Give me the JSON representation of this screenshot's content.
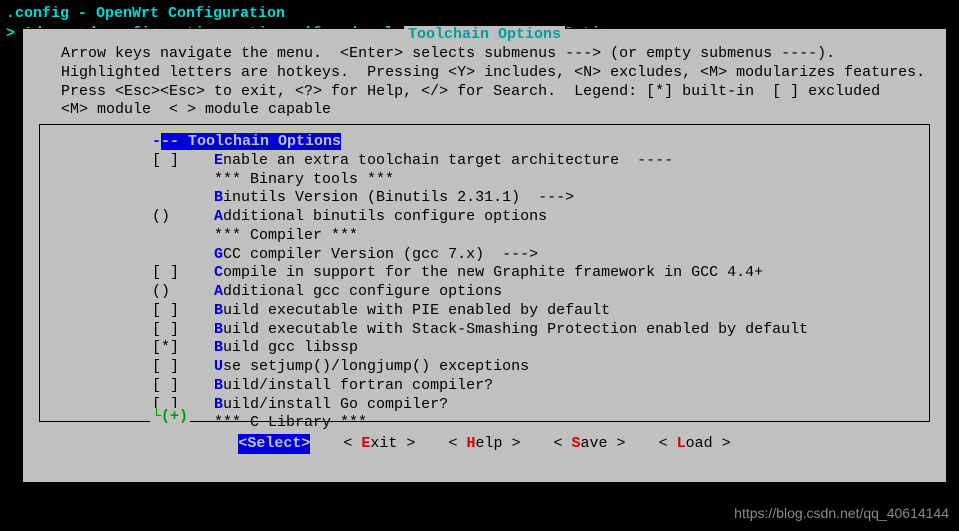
{
  "titleBar": ".config - OpenWrt Configuration",
  "breadcrumb": {
    "prefix": " > ",
    "parent": "Advanced configuration options (for developers)",
    "sep": " > ",
    "current": "Toolchain Options"
  },
  "panel": {
    "title": "Toolchain Options",
    "help": "  Arrow keys navigate the menu.  <Enter> selects submenus ---> (or empty submenus ----).\n  Highlighted letters are hotkeys.  Pressing <Y> includes, <N> excludes, <M> modularizes features.\n  Press <Esc><Esc> to exit, <?> for Help, </> for Search.  Legend: [*] built-in  [ ] excluded\n  <M> module  < > module capable",
    "moreIndicator": "└(+)"
  },
  "menuItems": [
    {
      "bracket": "---",
      "hotkey": "",
      "text": " Toolchain Options",
      "highlighted": true
    },
    {
      "bracket": "[ ]",
      "hotkey": "E",
      "text": "nable an extra toolchain target architecture  ----"
    },
    {
      "bracket": "   ",
      "hotkey": "",
      "text": "*** Binary tools ***"
    },
    {
      "bracket": "   ",
      "hotkey": "B",
      "text": "inutils Version (Binutils 2.31.1)  --->"
    },
    {
      "bracket": "() ",
      "hotkey": "A",
      "text": "dditional binutils configure options"
    },
    {
      "bracket": "   ",
      "hotkey": "",
      "text": "*** Compiler ***"
    },
    {
      "bracket": "   ",
      "hotkey": "G",
      "text": "CC compiler Version (gcc 7.x)  --->"
    },
    {
      "bracket": "[ ]",
      "hotkey": "C",
      "text": "ompile in support for the new Graphite framework in GCC 4.4+"
    },
    {
      "bracket": "() ",
      "hotkey": "A",
      "text": "dditional gcc configure options"
    },
    {
      "bracket": "[ ]",
      "hotkey": "B",
      "text": "uild executable with PIE enabled by default"
    },
    {
      "bracket": "[ ]",
      "hotkey": "B",
      "text": "uild executable with Stack-Smashing Protection enabled by default"
    },
    {
      "bracket": "[*]",
      "hotkey": "B",
      "text": "uild gcc libssp"
    },
    {
      "bracket": "[ ]",
      "hotkey": "U",
      "text": "se setjump()/longjump() exceptions"
    },
    {
      "bracket": "[ ]",
      "hotkey": "B",
      "text": "uild/install fortran compiler?"
    },
    {
      "bracket": "[ ]",
      "hotkey": "B",
      "text": "uild/install Go compiler?"
    },
    {
      "bracket": "   ",
      "hotkey": "",
      "text": "*** C Library ***"
    }
  ],
  "buttons": {
    "select": "<Select>",
    "exit": {
      "pre": "< ",
      "hot": "E",
      "post": "xit >"
    },
    "help": {
      "pre": "< ",
      "hot": "H",
      "post": "elp >"
    },
    "save": {
      "pre": "< ",
      "hot": "S",
      "post": "ave >"
    },
    "load": {
      "pre": "< ",
      "hot": "L",
      "post": "oad >"
    }
  },
  "watermark": "https://blog.csdn.net/qq_40614144"
}
